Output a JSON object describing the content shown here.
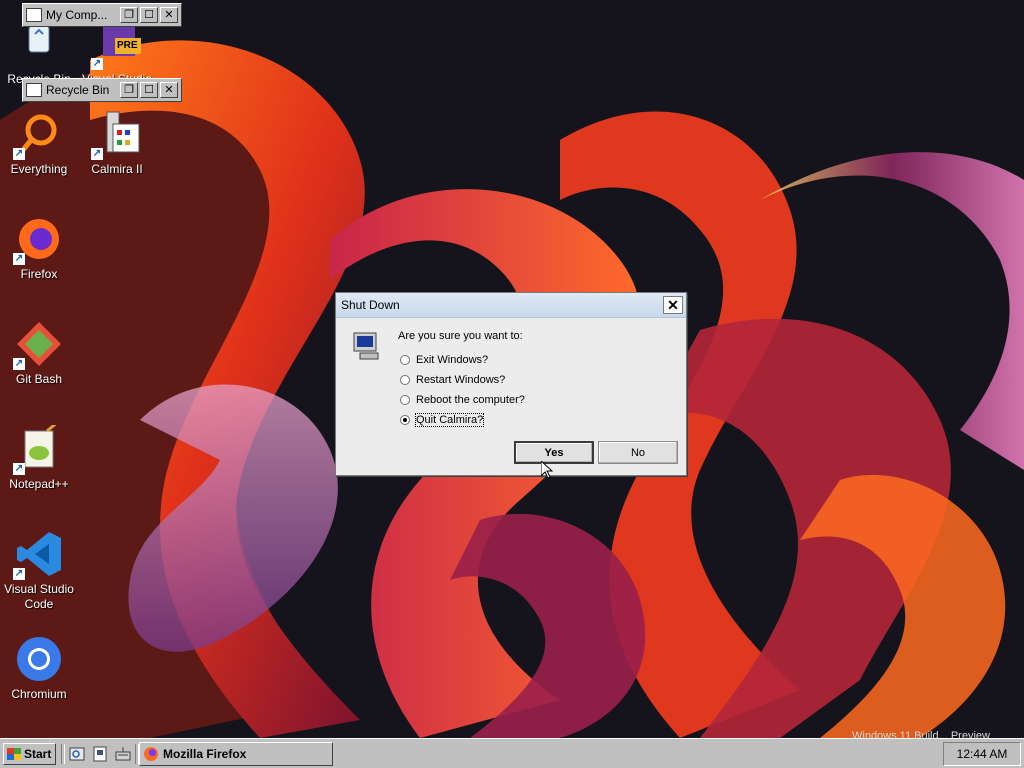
{
  "desktop": {
    "icons": [
      {
        "label": "Recycle Bin"
      },
      {
        "label": "Visual Studio",
        "badge": "PRE"
      },
      {
        "label": "Everything"
      },
      {
        "label": "Calmira II"
      },
      {
        "label": "Firefox"
      },
      {
        "label": "Git Bash"
      },
      {
        "label": "Notepad++"
      },
      {
        "label": "Visual Studio Code"
      },
      {
        "label": "Chromium"
      }
    ],
    "watermark": "Windows 11 Build... Preview"
  },
  "minimized_windows": [
    {
      "title": "My Comp..."
    },
    {
      "title": "Recycle Bin"
    }
  ],
  "dialog": {
    "title": "Shut Down",
    "question": "Are you sure you want to:",
    "options": [
      {
        "label": "Exit Windows?",
        "selected": false
      },
      {
        "label": "Restart Windows?",
        "selected": false
      },
      {
        "label": "Reboot the computer?",
        "selected": false
      },
      {
        "label": "Quit Calmira?",
        "selected": true
      }
    ],
    "yes_label": "Yes",
    "no_label": "No",
    "close_glyph": "✕"
  },
  "taskbar": {
    "start_label": "Start",
    "tasks": [
      {
        "label": "Mozilla Firefox"
      }
    ],
    "clock": "12:44 AM"
  },
  "window_glyphs": {
    "restore": "❐",
    "maximize": "☐",
    "close": "✕"
  }
}
